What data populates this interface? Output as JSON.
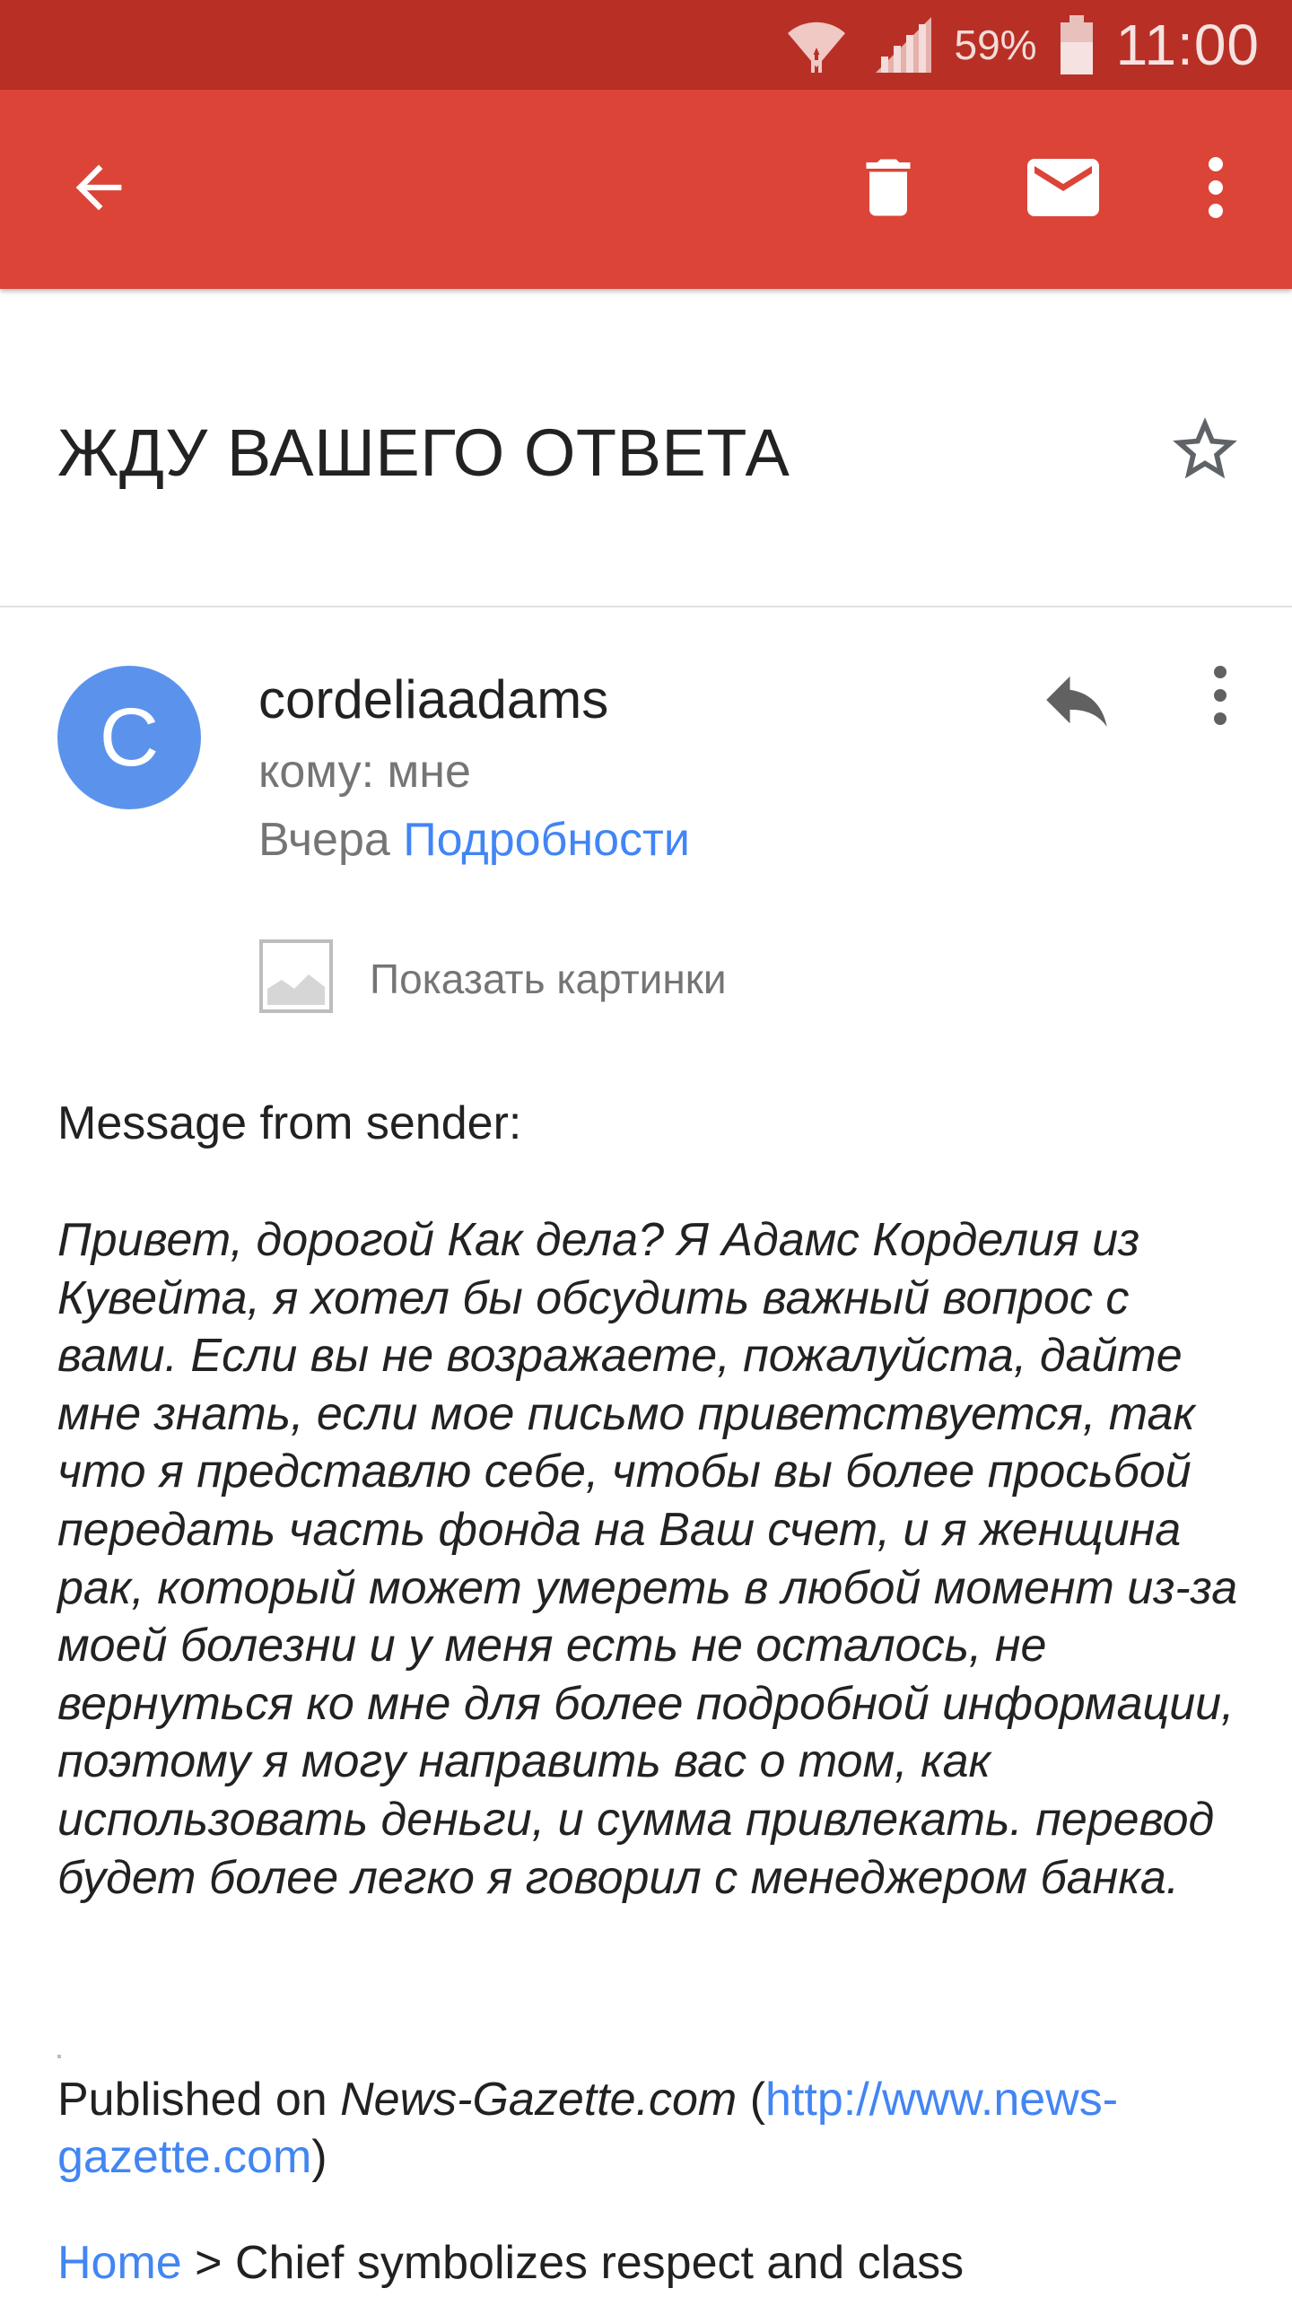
{
  "status_bar": {
    "battery_percent": "59%",
    "time": "11:00"
  },
  "toolbar": {
    "back_icon": "arrow-back-icon",
    "delete_icon": "trash-icon",
    "mark_unread_icon": "mail-icon",
    "more_icon": "more-vert-icon"
  },
  "email": {
    "subject": "ЖДУ ВАШЕГО ОТВЕТА",
    "sender_initial": "C",
    "sender": "cordeliaadams",
    "to": "кому: мне",
    "date": "Вчера",
    "details_link": "Подробности",
    "show_images": "Показать картинки",
    "intro": "Message from sender:",
    "body": "Привет, дорогой Как дела? Я Адамс Корделия из Кувейта, я хотел бы обсудить важный вопрос с вами. Если вы не возражаете, пожалуйста, дайте мне знать, если мое письмо приветствуется, так что я представлю себе, чтобы вы более просьбой передать часть фонда на Ваш счет, и я женщина рак, который может умереть в любой момент из-за моей болезни и у меня есть не осталось, не вернуться ко мне для более подробной информации, поэтому я могу направить вас о том, как использовать деньги, и сумма привлекать. перевод будет более легко я говорил с менеджером банка.",
    "published_prefix": "Published on ",
    "published_site": "News-Gazette.com",
    "published_open": " (",
    "published_url": "http://www.news-gazette.com",
    "published_close": ")",
    "breadcrumb_home": "Home",
    "breadcrumb_rest": " > Chief symbolizes respect and class"
  },
  "colors": {
    "status_bar": "#b83025",
    "app_bar": "#db4437",
    "avatar": "#5b93ec",
    "link": "#4285f4"
  }
}
